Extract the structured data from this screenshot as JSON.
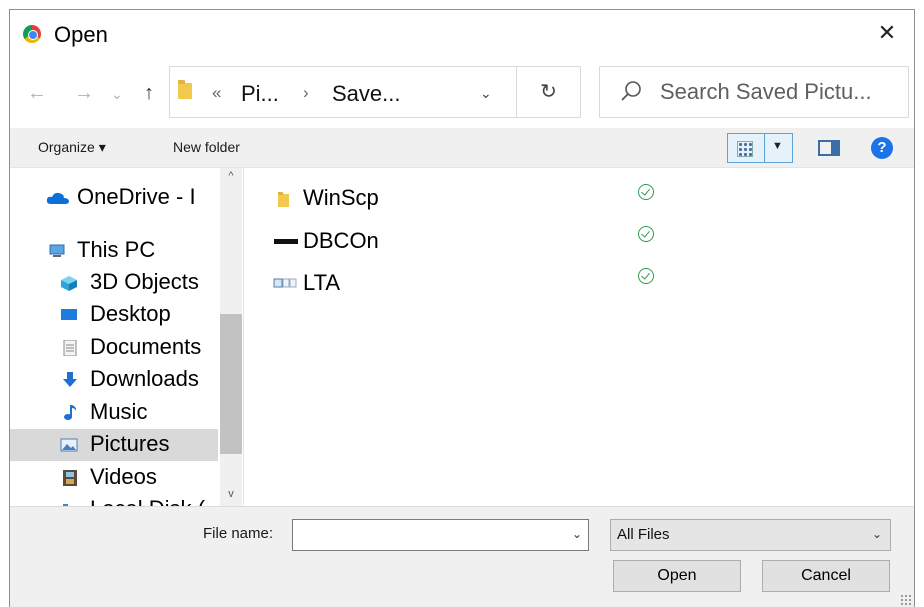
{
  "window": {
    "title": "Open",
    "close_glyph": "✕"
  },
  "nav": {
    "back_glyph": "←",
    "forward_glyph": "→",
    "recent_glyph": "⌄",
    "up_glyph": "↑"
  },
  "address": {
    "overflow_glyph": "«",
    "segments": [
      "Pi...",
      "Save..."
    ],
    "separator": "›",
    "dropdown_glyph": "⌄",
    "refresh_glyph": "↻"
  },
  "search": {
    "placeholder": "Search Saved Pictu..."
  },
  "toolbar": {
    "organize_label": "Organize ▾",
    "new_folder_label": "New folder",
    "help_label": "?"
  },
  "sidebar": {
    "items": [
      {
        "label": "OneDrive - I",
        "icon": "cloud-icon"
      },
      {
        "label": "This PC",
        "icon": "pc-icon"
      },
      {
        "label": "3D Objects",
        "icon": "cube-icon"
      },
      {
        "label": "Desktop",
        "icon": "desktop-icon"
      },
      {
        "label": "Documents",
        "icon": "document-icon"
      },
      {
        "label": "Downloads",
        "icon": "download-icon"
      },
      {
        "label": "Music",
        "icon": "music-icon"
      },
      {
        "label": "Pictures",
        "icon": "picture-icon",
        "selected": true
      },
      {
        "label": "Videos",
        "icon": "video-icon"
      },
      {
        "label": "Local Disk (",
        "icon": "disk-icon"
      }
    ],
    "scroll_up_glyph": "^",
    "scroll_down_glyph": "v"
  },
  "files": [
    {
      "name": "WinScp",
      "icon": "folder-icon",
      "status": "synced-icon"
    },
    {
      "name": "DBCOn",
      "icon": "shortcut-icon",
      "status": "synced-icon"
    },
    {
      "name": "LTA",
      "icon": "image-file-icon",
      "status": "synced-icon"
    }
  ],
  "footer": {
    "file_name_label": "File name:",
    "file_name_value": "",
    "file_type": "All Files",
    "dropdown_glyph": "⌄",
    "open_label": "Open",
    "cancel_label": "Cancel"
  },
  "colors": {
    "accent": "#1a73e8",
    "folder": "#f2c94c",
    "status_ok": "#2e9b4e",
    "selection": "#d9d9d9"
  }
}
